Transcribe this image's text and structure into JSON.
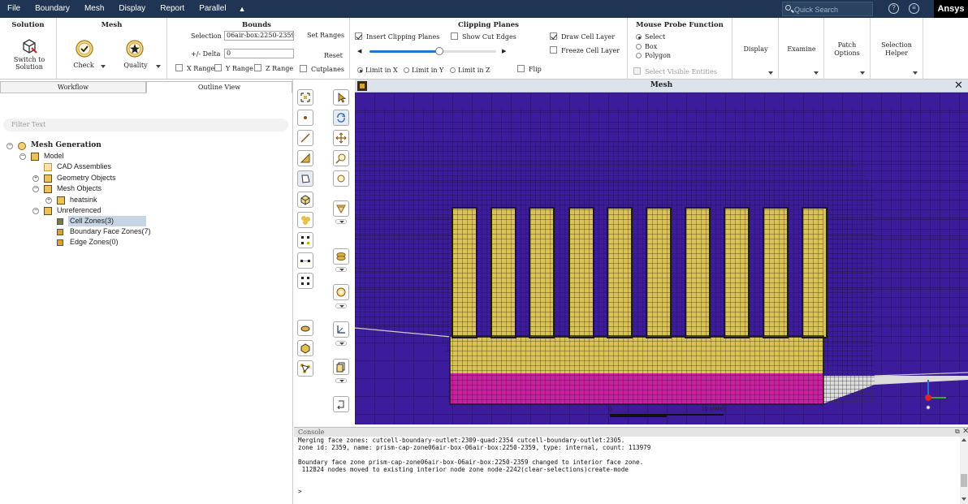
{
  "menubar": {
    "items": [
      "File",
      "Boundary",
      "Mesh",
      "Display",
      "Report",
      "Parallel"
    ],
    "collapse_icon": "chevron-up-icon",
    "search_placeholder": "Quick Search",
    "brand": "Ansys"
  },
  "ribbon": {
    "solution": {
      "title": "Solution",
      "button": "Switch to Solution",
      "icon": "switch-to-solution-icon"
    },
    "mesh": {
      "title": "Mesh",
      "check": "Check",
      "quality": "Quality"
    },
    "bounds": {
      "title": "Bounds",
      "selection_label": "Selection",
      "selection_value": "06air-box:2250-2359",
      "delta_label": "+/- Delta",
      "delta_value": "0",
      "set_ranges": "Set Ranges",
      "reset": "Reset",
      "x_range": "X Range",
      "y_range": "Y Range",
      "z_range": "Z Range",
      "cutplanes": "Cutplanes"
    },
    "clipping": {
      "title": "Clipping Planes",
      "insert": "Insert Clipping Planes",
      "show_cut_edges": "Show Cut Edges",
      "draw_cell_layer": "Draw Cell Layer",
      "freeze_cell_layer": "Freeze Cell Layer",
      "limit_x": "Limit in X",
      "limit_y": "Limit in Y",
      "limit_z": "Limit in Z",
      "flip": "Flip",
      "slider_fraction": 0.55
    },
    "probe": {
      "title": "Mouse Probe Function",
      "select": "Select",
      "box": "Box",
      "polygon": "Polygon",
      "select_visible": "Select Visible Entities"
    },
    "display": "Display",
    "examine": "Examine",
    "patch_options": "Patch Options",
    "selection_helper": "Selection Helper"
  },
  "left": {
    "tabs": [
      "Workflow",
      "Outline View"
    ],
    "filter_placeholder": "Filter Text",
    "tree": [
      {
        "label": "Mesh Generation",
        "toggle": "−",
        "bold": true
      },
      {
        "label": "Model",
        "toggle": "−"
      },
      {
        "label": "CAD Assemblies",
        "toggle": ""
      },
      {
        "label": "Geometry Objects",
        "toggle": "+"
      },
      {
        "label": "Mesh Objects",
        "toggle": "−"
      },
      {
        "label": "heatsink",
        "toggle": "+"
      },
      {
        "label": "Unreferenced",
        "toggle": "−"
      },
      {
        "label": "Cell Zones(3)",
        "toggle": "",
        "selected": true
      },
      {
        "label": "Boundary Face Zones(7)",
        "toggle": ""
      },
      {
        "label": "Edge Zones(0)",
        "toggle": ""
      }
    ]
  },
  "graphics": {
    "title": "Mesh",
    "scale_start": "0",
    "scale_end": "10",
    "scale_unit": "(mm)",
    "colors": {
      "air": "#3d1c9c",
      "heatsink": "#d9c257",
      "base": "#c8219f",
      "edge": "#1a1a1a"
    }
  },
  "console": {
    "title": "Console",
    "lines": [
      "Merging face zones: cutcell-boundary-outlet:2309-quad:2354 cutcell-boundary-outlet:2305.",
      "zone id: 2359, name: prism-cap-zone06air-box-06air-box:2250-2359, type: internal, count: 113979",
      "",
      "Boundary face zone prism-cap-zone06air-box-06air-box:2250-2359 changed to interior face zone.",
      " 112824 nodes moved to existing interior node zone node-2242(clear-selections)create-mode",
      "",
      "",
      ">"
    ]
  }
}
